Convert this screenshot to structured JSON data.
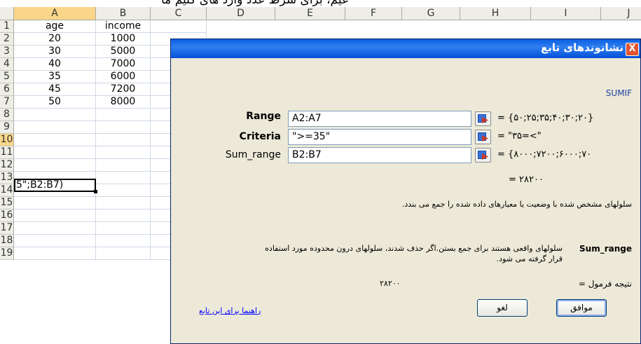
{
  "caption": "عیم، برای شرط عدد وارد های کنیم ما",
  "sheet": {
    "columns": [
      "A",
      "B",
      "C",
      "D",
      "E",
      "F",
      "G",
      "H",
      "I",
      "J"
    ],
    "selected_column": "A",
    "rows": [
      "1",
      "2",
      "3",
      "4",
      "5",
      "6",
      "7",
      "8",
      "9",
      "10",
      "11",
      "12",
      "13",
      "14",
      "15",
      "16",
      "17",
      "18",
      "19"
    ],
    "selected_row": "10",
    "col_a": [
      "age",
      "20",
      "30",
      "40",
      "35",
      "45",
      "50"
    ],
    "col_b": [
      "income",
      "1000",
      "5000",
      "7000",
      "6000",
      "7200",
      "8000"
    ],
    "active_cell_text": "5\";B2:B7)"
  },
  "dialog": {
    "title": "نشانوندهای تابع",
    "close": "X",
    "function_name": "SUMIF",
    "args": [
      {
        "label": "Range",
        "value": "A2:A7",
        "result": "= {۵۰;۲۵;۳۵;۴۰;۳۰;۲۰}"
      },
      {
        "label": "Criteria",
        "value": "\">=35\"",
        "result": "= \"۳۵=<\""
      },
      {
        "label": "Sum_range",
        "value": "B2:B7",
        "result": "= {۸۰۰۰;۷۲۰۰;۶۰۰۰;۷۰"
      }
    ],
    "formula_result_inline": "= ۲۸۲۰۰",
    "description": "سلولهای مشخص شده با وضعیت یا معیارهای داده شده را جمع می بندد.",
    "current_arg_name": "Sum_range",
    "current_arg_desc": "سلولهای واقعی هستند برای جمع بستن.اگر حذف شدند، سلولهای درون محدوده مورد استفاده قرار گرفته می شود.",
    "result_label": "نتیجه فرمول =",
    "result_value": "۲۸۲۰۰",
    "help_link": "راهنما برای این تابع",
    "ok_label": "موافق",
    "cancel_label": "لغو"
  }
}
